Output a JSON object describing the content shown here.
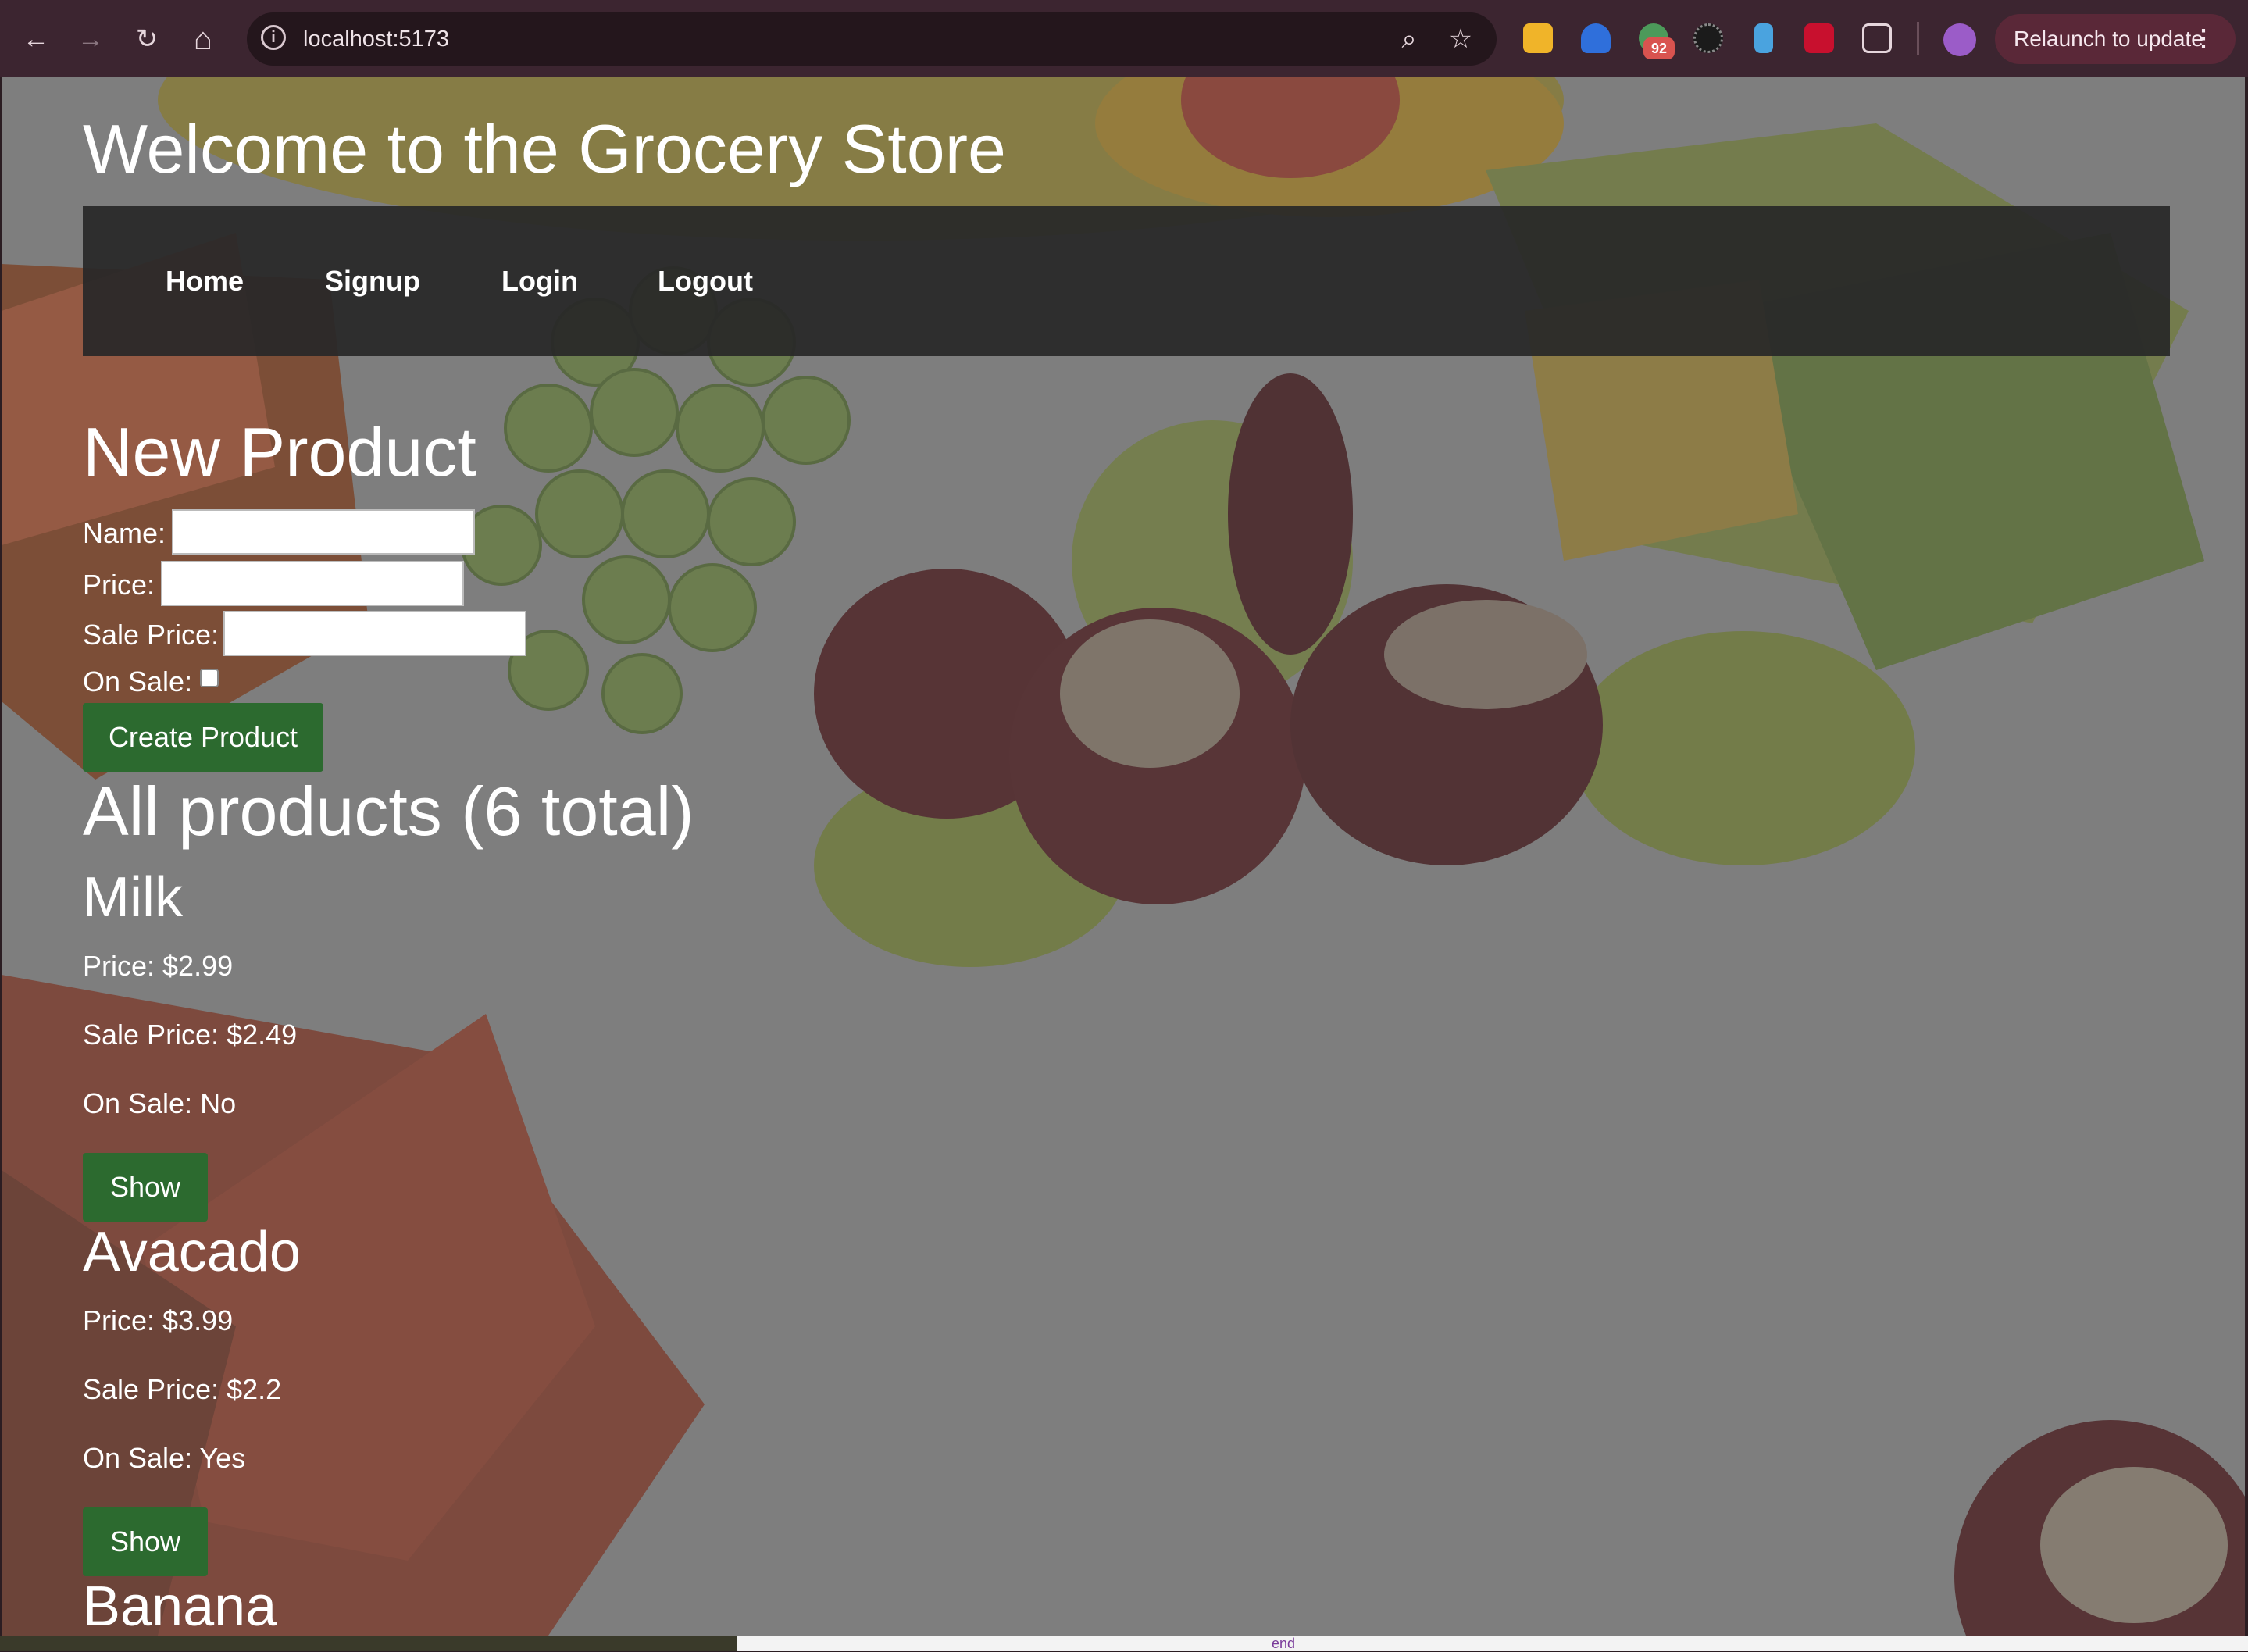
{
  "browser": {
    "url": "localhost:5173",
    "badge_count": "92",
    "relaunch_label": "Relaunch to update",
    "back_icon": "←",
    "forward_icon": "→",
    "reload_icon": "↻",
    "home_icon": "⌂",
    "zoom_icon": "⌕",
    "star_icon": "☆",
    "kebab_icon": "⋮"
  },
  "page": {
    "title": "Welcome to the Grocery Store",
    "nav": [
      "Home",
      "Signup",
      "Login",
      "Logout"
    ]
  },
  "form": {
    "heading": "New Product",
    "name_label": "Name:",
    "price_label": "Price:",
    "sale_price_label": "Sale Price:",
    "on_sale_label": "On Sale:",
    "on_sale_checked": false,
    "submit_label": "Create Product"
  },
  "products": {
    "heading": "All products (6 total)",
    "items": [
      {
        "name": "Milk",
        "price": "Price: $2.99",
        "sale_price": "Sale Price: $2.49",
        "on_sale": "On Sale: No",
        "button": "Show"
      },
      {
        "name": "Avacado",
        "price": "Price: $3.99",
        "sale_price": "Sale Price: $2.2",
        "on_sale": "On Sale: Yes",
        "button": "Show"
      },
      {
        "name": "Banana"
      }
    ]
  },
  "bottom_strip_text": "end",
  "colors": {
    "chrome": "#3c2530",
    "button_green": "#2c6a2f",
    "navbar": "#282828"
  }
}
